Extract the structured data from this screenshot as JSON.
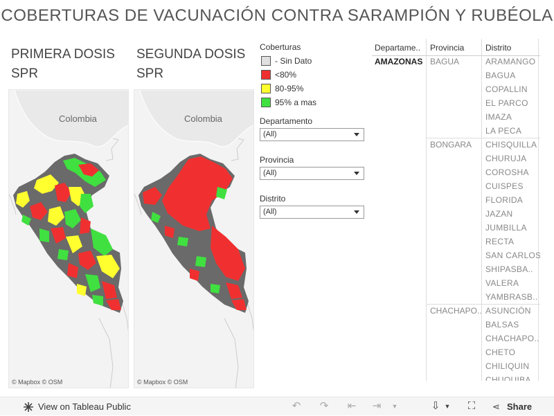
{
  "page": {
    "title": "COBERTURAS DE VACUNACIÓN CONTRA SARAMPIÓN Y RUBÉOLA"
  },
  "maps": [
    {
      "title_line1": "PRIMERA DOSIS",
      "title_line2": "SPR",
      "country_label": "Colombia",
      "credit_mapbox": "© Mapbox",
      "credit_osm": "© OSM"
    },
    {
      "title_line1": "SEGUNDA DOSIS",
      "title_line2": "SPR",
      "country_label": "Colombia",
      "credit_mapbox": "© Mapbox",
      "credit_osm": "© OSM"
    }
  ],
  "legend": {
    "title": "Coberturas",
    "items": [
      {
        "label": "- Sin Dato",
        "color": "#e0e0e0"
      },
      {
        "label": "<80%",
        "color": "#f03030"
      },
      {
        "label": "80-95%",
        "color": "#ffff30"
      },
      {
        "label": "95% a mas",
        "color": "#40e040"
      }
    ]
  },
  "filters": [
    {
      "label": "Departamento",
      "value": "(All)"
    },
    {
      "label": "Provincia",
      "value": "(All)"
    },
    {
      "label": "Distrito",
      "value": "(All)"
    }
  ],
  "table": {
    "headers": [
      "Departame..",
      "Provincia",
      "Distrito"
    ],
    "department": "AMAZONAS",
    "groups": [
      {
        "province": "BAGUA",
        "districts": [
          "ARAMANGO",
          "BAGUA",
          "COPALLIN",
          "EL PARCO",
          "IMAZA",
          "LA PECA"
        ]
      },
      {
        "province": "BONGARA",
        "districts": [
          "CHISQUILLA",
          "CHURUJA",
          "COROSHA",
          "CUISPES",
          "FLORIDA",
          "JAZAN",
          "JUMBILLA",
          "RECTA",
          "SAN CARLOS",
          "SHIPASBA..",
          "VALERA",
          "YAMBRASB.."
        ]
      },
      {
        "province": "CHACHAPO..",
        "districts": [
          "ASUNCIÓN",
          "BALSAS",
          "CHACHAPO..",
          "CHETO",
          "CHILIQUIN",
          "CHUQUIBA"
        ]
      }
    ]
  },
  "toolbar": {
    "view_label": "View on Tableau Public",
    "share_label": "Share"
  }
}
